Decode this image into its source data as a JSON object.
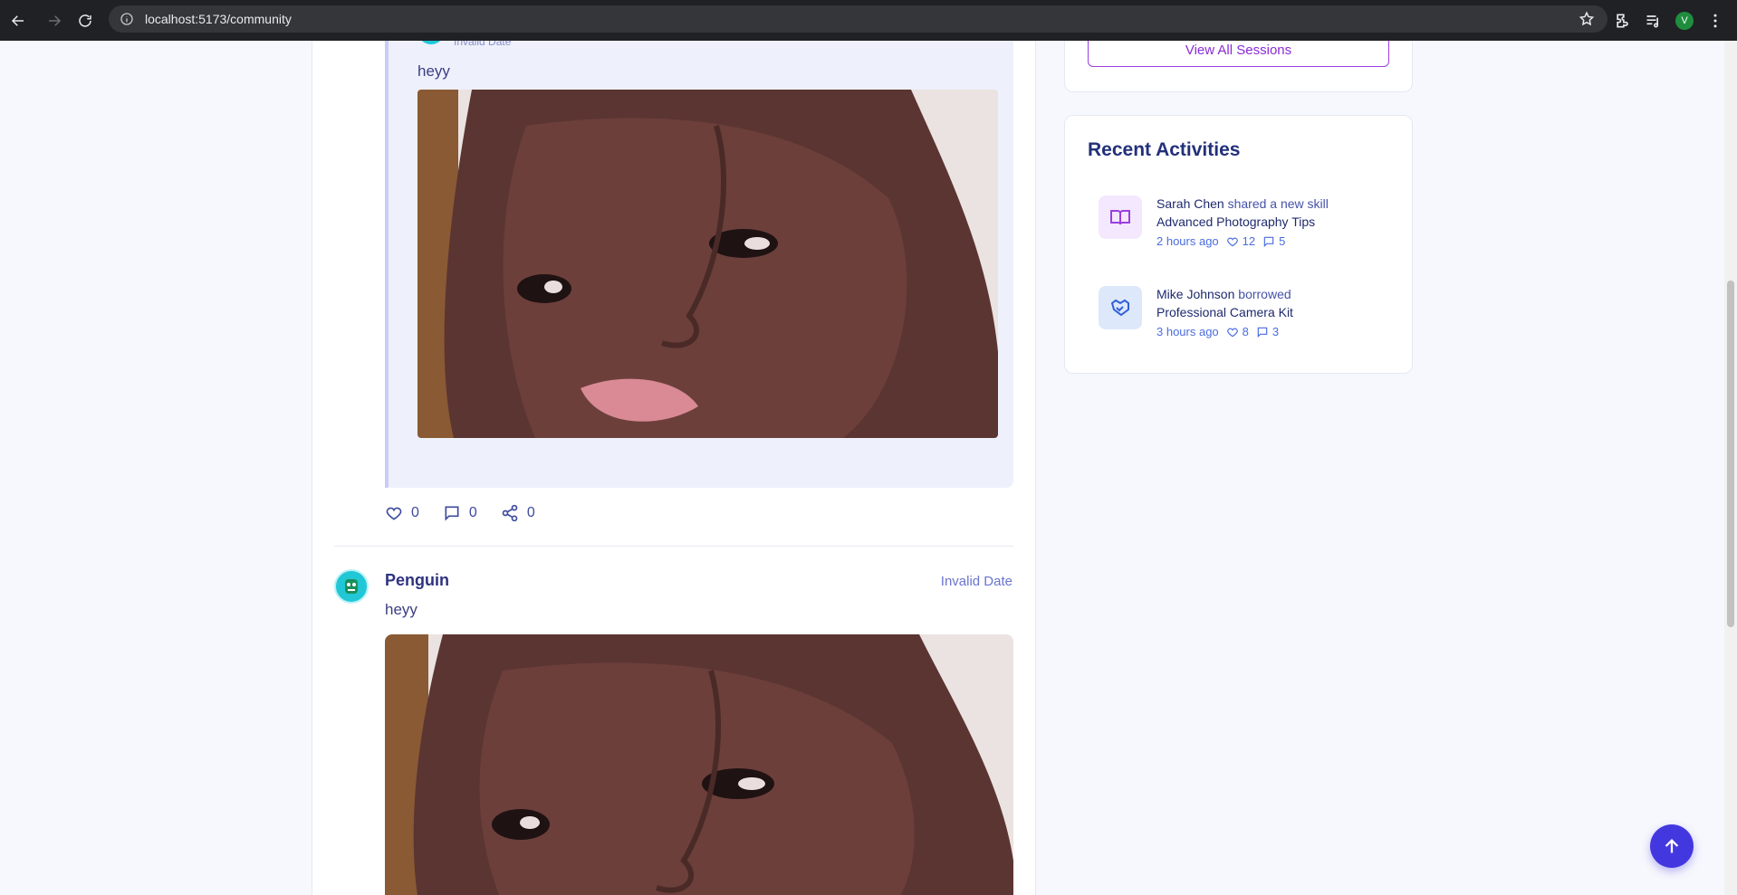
{
  "browser": {
    "url": "localhost:5173/community",
    "profile_initial": "V"
  },
  "quoted_post": {
    "date": "Invalid Date",
    "text": "heyy"
  },
  "actions": {
    "likes": "0",
    "comments": "0",
    "shares": "0"
  },
  "post": {
    "author": "Penguin",
    "date": "Invalid Date",
    "text": "heyy"
  },
  "sessions": {
    "view_all_label": "View All Sessions"
  },
  "recent_activities": {
    "title": "Recent Activities",
    "items": [
      {
        "name": "Sarah Chen",
        "verb": "shared a new skill",
        "item": "Advanced Photography Tips",
        "time": "2 hours ago",
        "likes": "12",
        "comments": "5",
        "icon": "book-open-icon",
        "icon_color": "#9b3fe0",
        "icon_bg": "#f3e8fd"
      },
      {
        "name": "Mike Johnson",
        "verb": "borrowed",
        "item": "Professional Camera Kit",
        "time": "3 hours ago",
        "likes": "8",
        "comments": "3",
        "icon": "handshake-icon",
        "icon_color": "#2f5fd8",
        "icon_bg": "#dde8fb"
      }
    ]
  },
  "colors": {
    "accent": "#4338e0",
    "purple": "#9b3fe0",
    "text_dark": "#22307a"
  }
}
